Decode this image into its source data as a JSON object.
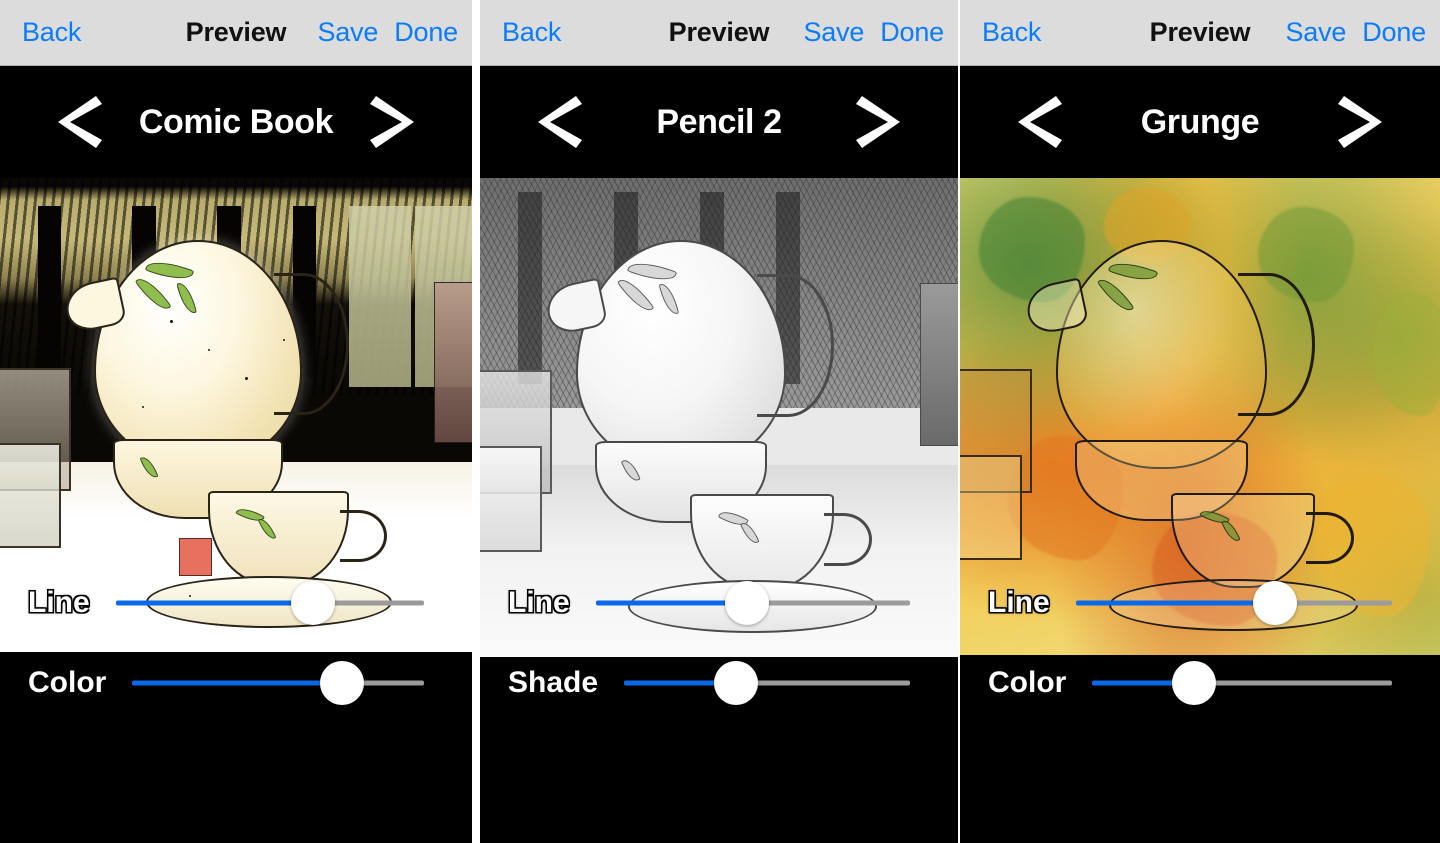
{
  "app": {
    "accent_blue": "#0a7cff",
    "slider_fill": "#0a69e8",
    "slider_rest": "#9b9b9b",
    "navbar_bg": "#dcdcdc",
    "panel_bg": "#000000"
  },
  "panels": [
    {
      "navbar": {
        "back_label": "Back",
        "title": "Preview",
        "save_label": "Save",
        "done_label": "Done"
      },
      "filter": {
        "name": "Comic Book",
        "prev_icon": "chevron-left-icon",
        "next_icon": "chevron-right-icon"
      },
      "sliders": [
        {
          "label": "Line",
          "value_pct": 64,
          "on_photo": true
        },
        {
          "label": "Color",
          "value_pct": 72,
          "on_photo": false
        }
      ]
    },
    {
      "navbar": {
        "back_label": "Back",
        "title": "Preview",
        "save_label": "Save",
        "done_label": "Done"
      },
      "filter": {
        "name": "Pencil 2",
        "prev_icon": "chevron-left-icon",
        "next_icon": "chevron-right-icon"
      },
      "sliders": [
        {
          "label": "Line",
          "value_pct": 48,
          "on_photo": true
        },
        {
          "label": "Shade",
          "value_pct": 39,
          "on_photo": false
        }
      ]
    },
    {
      "navbar": {
        "back_label": "Back",
        "title": "Preview",
        "save_label": "Save",
        "done_label": "Done"
      },
      "filter": {
        "name": "Grunge",
        "prev_icon": "chevron-left-icon",
        "next_icon": "chevron-right-icon"
      },
      "sliders": [
        {
          "label": "Line",
          "value_pct": 63,
          "on_photo": true
        },
        {
          "label": "Color",
          "value_pct": 34,
          "on_photo": false
        }
      ]
    }
  ],
  "photo_subject": "teapot and teacups on a table"
}
